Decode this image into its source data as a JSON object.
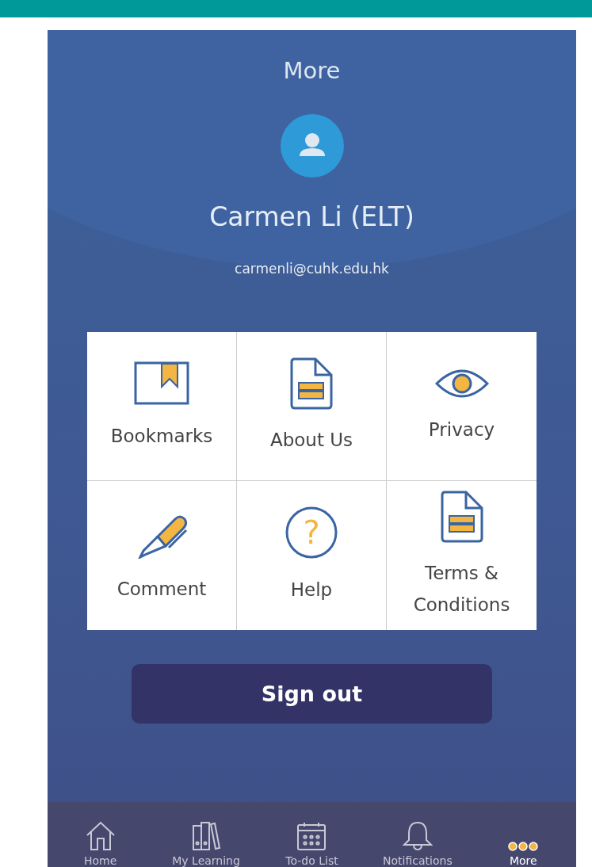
{
  "header": {
    "title": "More"
  },
  "profile": {
    "name": "Carmen Li (ELT)",
    "email": "carmenli@cuhk.edu.hk"
  },
  "menu": [
    {
      "kind": "bookmark",
      "label": "Bookmarks"
    },
    {
      "kind": "document",
      "label": "About Us"
    },
    {
      "kind": "eye",
      "label": "Privacy"
    },
    {
      "kind": "pen",
      "label": "Comment"
    },
    {
      "kind": "help",
      "label": "Help",
      "icon_text": "?"
    },
    {
      "kind": "document",
      "label": "Terms &\nConditions"
    }
  ],
  "sign_out": {
    "label": "Sign out"
  },
  "tabs": [
    {
      "kind": "home",
      "label": "Home",
      "selected": false
    },
    {
      "kind": "books",
      "label": "My Learning",
      "selected": false
    },
    {
      "kind": "calendar",
      "label": "To-do List",
      "selected": false
    },
    {
      "kind": "bell",
      "label": "Notifications",
      "selected": false
    },
    {
      "kind": "dots",
      "label": "More",
      "selected": true
    }
  ]
}
